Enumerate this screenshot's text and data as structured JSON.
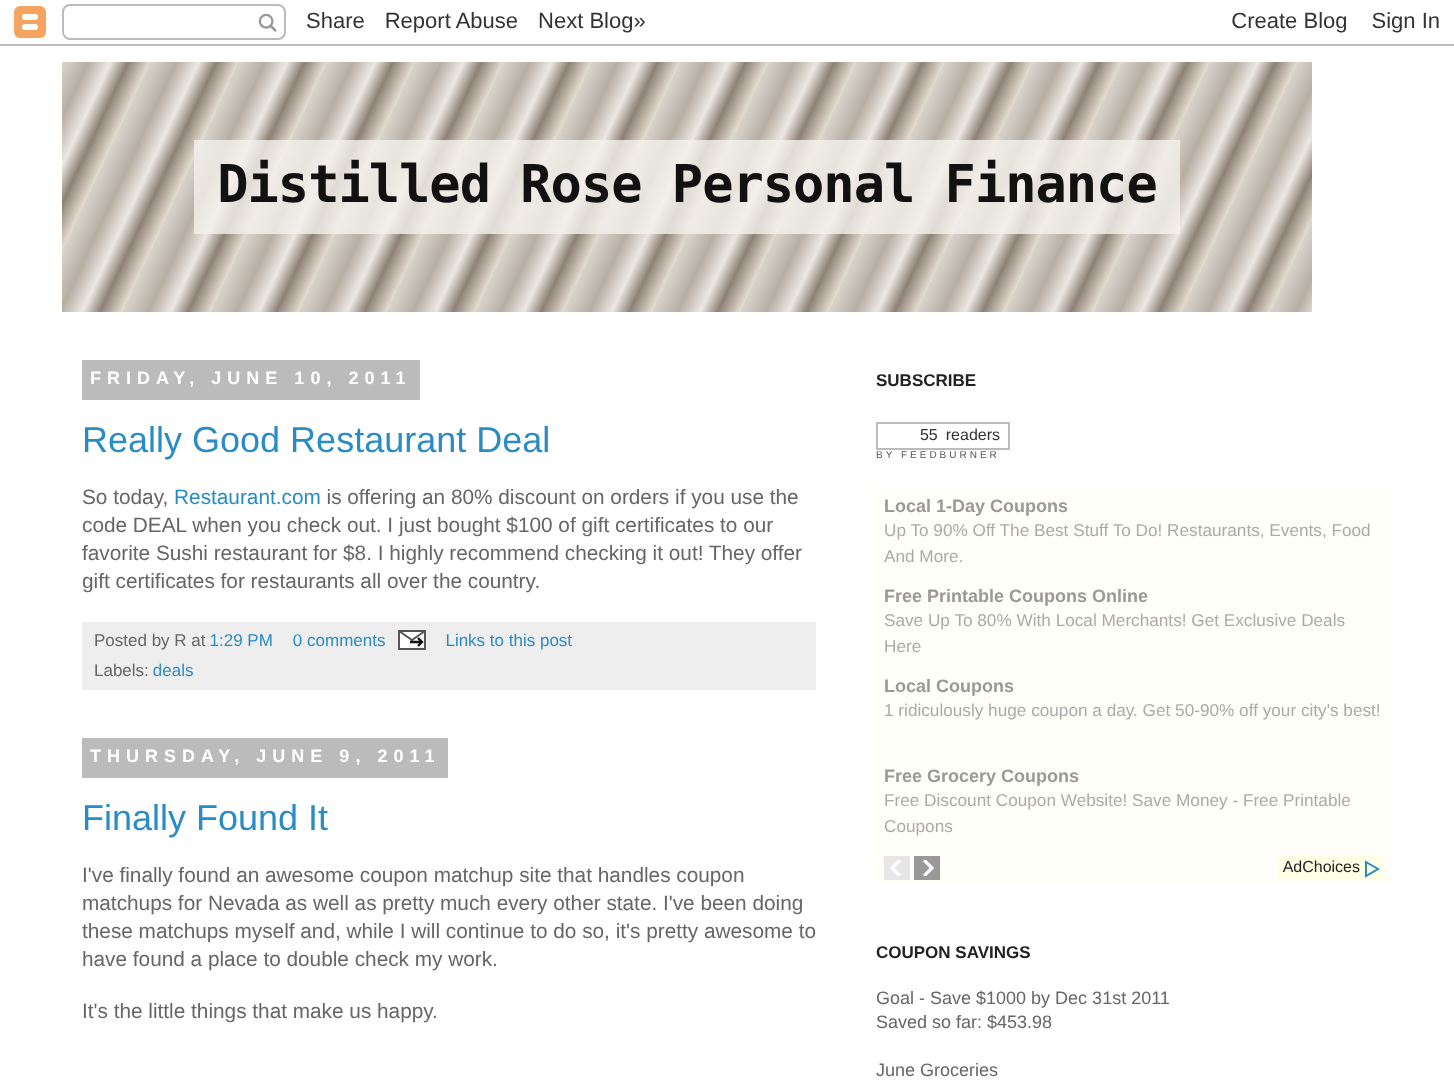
{
  "navbar": {
    "links": [
      "Share",
      "Report Abuse",
      "Next Blog»"
    ],
    "right_links": [
      "Create Blog",
      "Sign In"
    ]
  },
  "header": {
    "title": "Distilled Rose Personal Finance"
  },
  "posts": [
    {
      "date": "FRIDAY, JUNE 10, 2011",
      "title": "Really Good Restaurant Deal",
      "paragraphs": [
        {
          "before": "So today, ",
          "link": "Restaurant.com",
          "after": " is offering an 80% discount on orders if you use the code DEAL when you check out. I just bought $100 of gift certificates to our favorite Sushi restaurant for $8. I highly recommend checking it out! They offer gift certificates for restaurants all over the country."
        }
      ],
      "footer": {
        "posted_by": "Posted by R at",
        "time": "1:29 PM",
        "comments": "0 comments",
        "backlinks": "Links to this post",
        "labels_text": "Labels:",
        "labels": [
          "deals"
        ]
      }
    },
    {
      "date": "THURSDAY, JUNE 9, 2011",
      "title": "Finally Found It",
      "paragraphs": [
        {
          "before": "I've finally found an awesome coupon matchup site that handles coupon matchups for Nevada as well as pretty much every other state. I've been doing these matchups myself and, while I will continue to do so, it's pretty awesome to have found a place to double check my work."
        },
        {
          "before": "It's the little things that make us happy."
        }
      ]
    }
  ],
  "sidebar": {
    "subscribe": {
      "title": "SUBSCRIBE",
      "count": "55",
      "unit": "readers",
      "by": "BY FEEDBURNER"
    },
    "ads": [
      {
        "title": "Local 1-Day Coupons",
        "text": "Up To 90% Off The Best Stuff To Do! Restaurants, Events, Food And More."
      },
      {
        "title": "Free Printable Coupons Online",
        "text": "Save Up To 80% With Local Merchants! Get Exclusive Deals Here"
      },
      {
        "title": "Local Coupons",
        "text": "1 ridiculously huge coupon a day. Get 50-90% off your city's best!"
      },
      {
        "title": "Free Grocery Coupons",
        "text": "Free Discount Coupon Website! Save Money - Free Printable Coupons"
      }
    ],
    "ad_nav": {
      "prev_disabled": true,
      "next_disabled": false
    },
    "adchoices": "AdChoices",
    "savings": {
      "title": "COUPON SAVINGS",
      "lines": [
        "Goal - Save $1000 by Dec 31st 2011",
        "Saved so far: $453.98"
      ],
      "next": "June Groceries"
    }
  }
}
